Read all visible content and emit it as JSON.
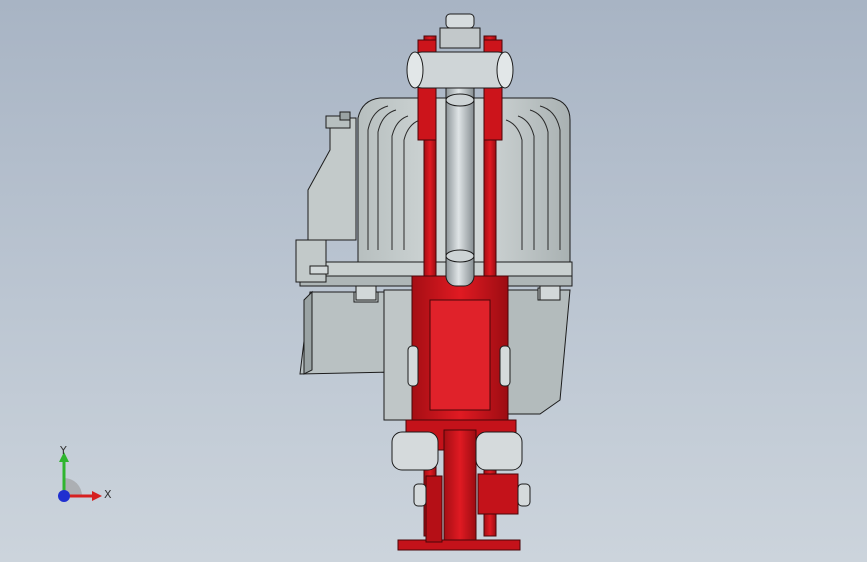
{
  "viewport": {
    "background_top": "#a8b4c4",
    "background_bottom": "#ccd4dc"
  },
  "model": {
    "description_name": "brake-assembly-front-view",
    "colors": {
      "housing": "#c6cdcd",
      "housing_dark": "#9aa3a4",
      "red_part": "#d8141c",
      "red_dark": "#8a0b10",
      "edge": "#1c1c1c",
      "shaft": "#bfc5c8"
    }
  },
  "triad": {
    "y_label": "Y",
    "x_label": "X",
    "y_color": "#2fb52f",
    "x_color": "#d62020",
    "z_color": "#1f2fd0"
  }
}
